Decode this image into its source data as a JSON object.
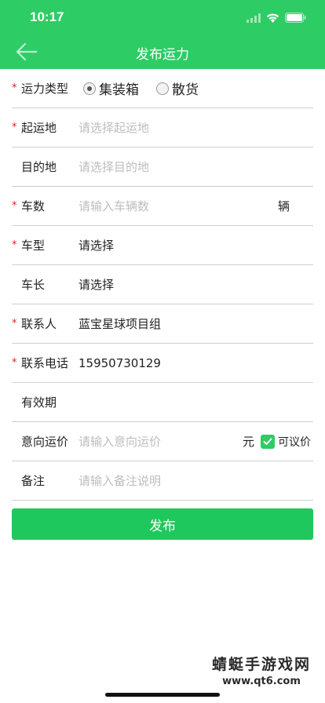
{
  "status_bar": {
    "time": "10:17"
  },
  "header": {
    "title": "发布运力",
    "back_icon": "arrow-left-icon"
  },
  "form": {
    "type": {
      "label": "运力类型",
      "options": [
        "集装箱",
        "散货"
      ],
      "selected": "集装箱"
    },
    "origin": {
      "label": "起运地",
      "placeholder": "请选择起运地"
    },
    "destination": {
      "label": "目的地",
      "placeholder": "请选择目的地"
    },
    "vehicle_count": {
      "label": "车数",
      "placeholder": "请输入车辆数",
      "unit": "辆"
    },
    "vehicle_type": {
      "label": "车型",
      "value": "请选择"
    },
    "vehicle_length": {
      "label": "车长",
      "value": "请选择"
    },
    "contact": {
      "label": "联系人",
      "value": "蓝宝星球项目组"
    },
    "phone": {
      "label": "联系电话",
      "value": "15950730129"
    },
    "validity": {
      "label": "有效期"
    },
    "price": {
      "label": "意向运价",
      "placeholder": "请输入意向运价",
      "unit": "元",
      "negotiable_label": "可议价",
      "negotiable": true
    },
    "remark": {
      "label": "备注",
      "placeholder": "请输入备注说明"
    }
  },
  "submit": {
    "label": "发布"
  },
  "watermark": {
    "text": "蜻蜓手游戏网",
    "url": "www.qt6.com"
  },
  "colors": {
    "primary": "#2ecc65",
    "required": "#e02020"
  }
}
